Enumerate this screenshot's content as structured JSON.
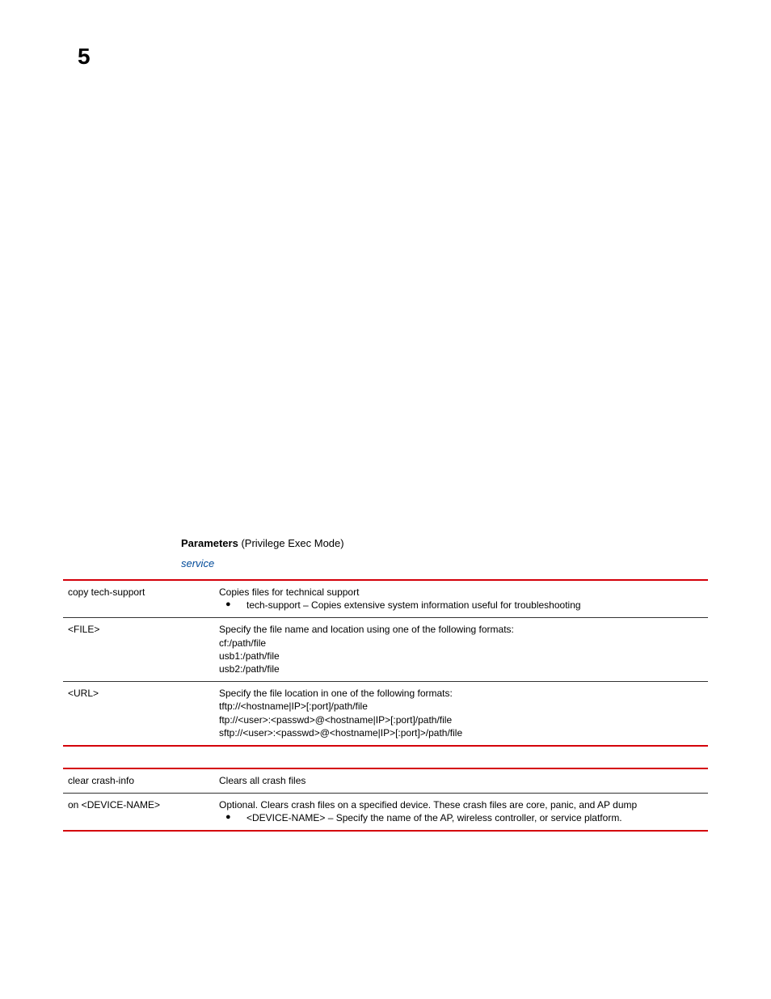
{
  "pageNumber": "5",
  "sectionTitle": {
    "bold": "Parameters",
    "rest": " (Privilege Exec Mode)"
  },
  "serviceLink": "service",
  "table1": {
    "rows": [
      {
        "name": "copy tech-support",
        "lines": [
          "Copies files for technical support"
        ],
        "bullets": [
          "tech-support – Copies extensive system information useful for troubleshooting"
        ]
      },
      {
        "name": "<FILE>",
        "lines": [
          "Specify the file name and location using one of the following formats:",
          "cf:/path/file",
          "usb1:/path/file",
          "usb2:/path/file"
        ],
        "bullets": []
      },
      {
        "name": "<URL>",
        "lines": [
          "Specify the file location in one of the following formats:",
          "tftp://<hostname|IP>[:port]/path/file",
          "ftp://<user>:<passwd>@<hostname|IP>[:port]/path/file",
          "sftp://<user>:<passwd>@<hostname|IP>[:port]>/path/file"
        ],
        "bullets": []
      }
    ]
  },
  "table2": {
    "rows": [
      {
        "name": "clear crash-info",
        "lines": [
          "Clears all crash files"
        ],
        "bullets": []
      },
      {
        "name": "on <DEVICE-NAME>",
        "lines": [
          "Optional. Clears crash files on a specified device. These crash files are core, panic, and AP dump"
        ],
        "bullets": [
          "<DEVICE-NAME> – Specify the name of the AP, wireless controller, or service platform."
        ]
      }
    ]
  }
}
